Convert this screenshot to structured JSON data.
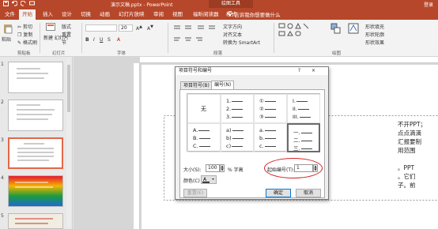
{
  "window": {
    "doc_title": "演示文稿.pptx - PowerPoint",
    "context_tools": "绘图工具",
    "login": "登录"
  },
  "tabs": [
    "文件",
    "开始",
    "插入",
    "设计",
    "切换",
    "动画",
    "幻灯片放映",
    "审阅",
    "视图",
    "福昕阅读器",
    "格式"
  ],
  "active_tab": "开始",
  "tell_me": "告诉我你想要做什么",
  "ribbon": {
    "clipboard": {
      "paste": "粘贴",
      "cut": "剪切",
      "copy": "复制",
      "format_painter": "格式刷",
      "group": "剪贴板"
    },
    "slides": {
      "new_slide": "新建\n幻灯片",
      "layout": "版式",
      "reset": "重置",
      "section": "节",
      "group": "幻灯片"
    },
    "font": {
      "font_size": "20",
      "group": "字体"
    },
    "paragraph": {
      "text_direction": "文字方向",
      "align_text": "对齐文本",
      "smartart": "转换为 SmartArt",
      "group": "段落"
    },
    "drawing": {
      "shape_fill": "形状填充",
      "shape_outline": "形状轮廓",
      "shape_effects": "形状效果",
      "group": "绘图"
    }
  },
  "thumbnails": [
    {
      "num": "1"
    },
    {
      "num": "2"
    },
    {
      "num": "3"
    },
    {
      "num": "4"
    },
    {
      "num": "5"
    }
  ],
  "slide_text": {
    "line1": "不开PPT；",
    "line2": "点点滴滴",
    "line3": "汇报要制",
    "line4": "用范围",
    "line5": "。PPT",
    "line6": "。它们",
    "line7": "子。前"
  },
  "dialog": {
    "title": "项目符号和编号",
    "help": "?",
    "close": "×",
    "tab_bullets": "项目符号(B)",
    "tab_numbering": "编号(N)",
    "none_label": "无",
    "col2": [
      "1.",
      "2.",
      "3."
    ],
    "col3": [
      "①",
      "②",
      "③"
    ],
    "col4": [
      "I.",
      "II.",
      "III."
    ],
    "row2_col1": [
      "A.",
      "B.",
      "C."
    ],
    "row2_col2": [
      "a)",
      "b)",
      "c)"
    ],
    "row2_col3": [
      "a.",
      "b.",
      "c."
    ],
    "row2_col4": [
      "一.",
      "二.",
      "三."
    ],
    "size_label": "大小(S):",
    "size_value": "100",
    "size_unit": "% 字高",
    "start_label": "起始编号(T):",
    "start_value": "1",
    "color_label": "颜色(C)",
    "reset": "重置(E)",
    "ok": "确定",
    "cancel": "取消"
  }
}
